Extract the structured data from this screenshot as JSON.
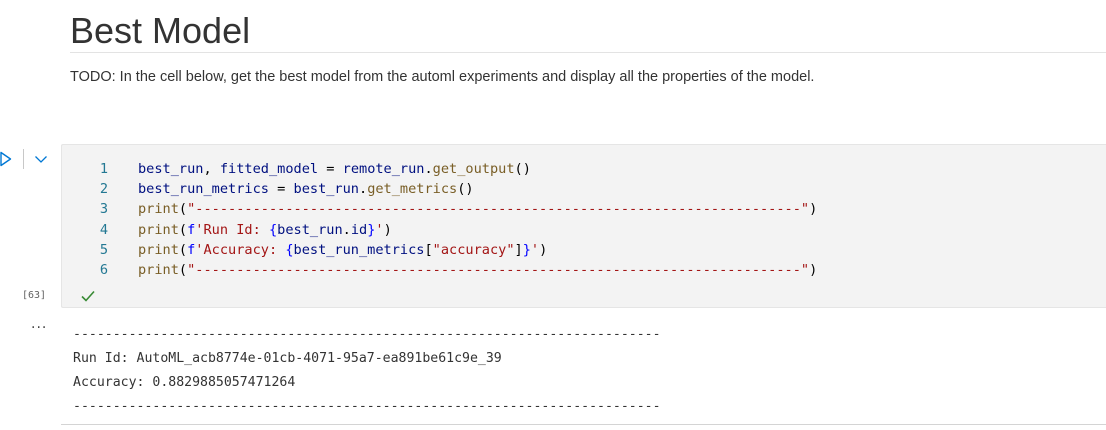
{
  "markdown": {
    "heading": "Best Model",
    "paragraph": "TODO: In the cell below, get the best model from the automl experiments and display all the properties of the model."
  },
  "cell": {
    "execution_count": "[63]",
    "status": "success",
    "lines": [
      {
        "num": "1",
        "tokens": [
          {
            "t": "var",
            "s": "best_run"
          },
          {
            "t": "op",
            "s": ", "
          },
          {
            "t": "var",
            "s": "fitted_model"
          },
          {
            "t": "op",
            "s": " = "
          },
          {
            "t": "var",
            "s": "remote_run"
          },
          {
            "t": "op",
            "s": "."
          },
          {
            "t": "fn",
            "s": "get_output"
          },
          {
            "t": "op",
            "s": "()"
          }
        ]
      },
      {
        "num": "2",
        "tokens": [
          {
            "t": "var",
            "s": "best_run_metrics"
          },
          {
            "t": "op",
            "s": " = "
          },
          {
            "t": "var",
            "s": "best_run"
          },
          {
            "t": "op",
            "s": "."
          },
          {
            "t": "fn",
            "s": "get_metrics"
          },
          {
            "t": "op",
            "s": "()"
          }
        ]
      },
      {
        "num": "3",
        "tokens": [
          {
            "t": "fn",
            "s": "print"
          },
          {
            "t": "op",
            "s": "("
          },
          {
            "t": "str",
            "s": "\"--------------------------------------------------------------------------\""
          },
          {
            "t": "op",
            "s": ")"
          }
        ]
      },
      {
        "num": "4",
        "tokens": [
          {
            "t": "fn",
            "s": "print"
          },
          {
            "t": "op",
            "s": "("
          },
          {
            "t": "f",
            "s": "f"
          },
          {
            "t": "str",
            "s": "'Run Id: "
          },
          {
            "t": "brace",
            "s": "{"
          },
          {
            "t": "var",
            "s": "best_run"
          },
          {
            "t": "op",
            "s": "."
          },
          {
            "t": "var",
            "s": "id"
          },
          {
            "t": "brace",
            "s": "}"
          },
          {
            "t": "str",
            "s": "'"
          },
          {
            "t": "op",
            "s": ")"
          }
        ]
      },
      {
        "num": "5",
        "tokens": [
          {
            "t": "fn",
            "s": "print"
          },
          {
            "t": "op",
            "s": "("
          },
          {
            "t": "f",
            "s": "f"
          },
          {
            "t": "str",
            "s": "'Accuracy: "
          },
          {
            "t": "brace",
            "s": "{"
          },
          {
            "t": "var",
            "s": "best_run_metrics"
          },
          {
            "t": "op",
            "s": "["
          },
          {
            "t": "str",
            "s": "\"accuracy\""
          },
          {
            "t": "op",
            "s": "]"
          },
          {
            "t": "brace",
            "s": "}"
          },
          {
            "t": "str",
            "s": "'"
          },
          {
            "t": "op",
            "s": ")"
          }
        ]
      },
      {
        "num": "6",
        "tokens": [
          {
            "t": "fn",
            "s": "print"
          },
          {
            "t": "op",
            "s": "("
          },
          {
            "t": "str",
            "s": "\"--------------------------------------------------------------------------\""
          },
          {
            "t": "op",
            "s": ")"
          }
        ]
      }
    ]
  },
  "output": {
    "more_label": "...",
    "lines": [
      "--------------------------------------------------------------------------",
      "Run Id: AutoML_acb8774e-01cb-4071-95a7-ea891be61c9e_39",
      "Accuracy: 0.8829885057471264",
      "--------------------------------------------------------------------------"
    ]
  },
  "colors": {
    "line_number": "#237893",
    "run_icon": "#0078d4",
    "success_check": "#388a34",
    "cell_background": "#f3f3f3"
  },
  "icons": {
    "run": "run-play-icon",
    "toggle": "chevron-down-icon",
    "status": "checkmark-icon"
  }
}
